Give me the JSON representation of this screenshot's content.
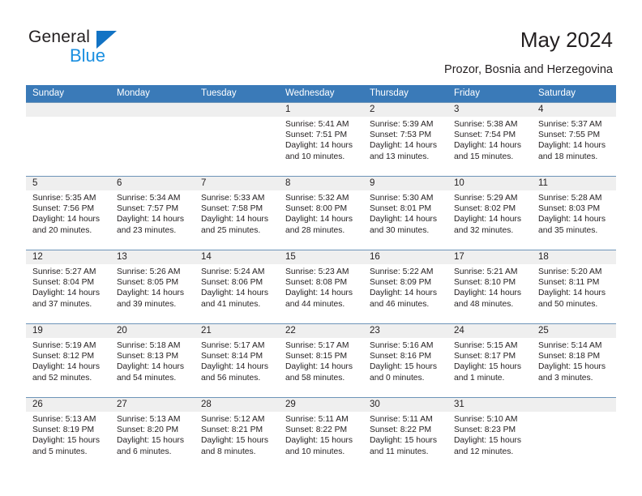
{
  "logo": {
    "primary_text": "General",
    "secondary_text": "Blue",
    "primary_color": "#231f20",
    "secondary_color": "#1a8fe0",
    "triangle_color": "#1273c4"
  },
  "header": {
    "title": "May 2024",
    "subtitle": "Prozor, Bosnia and Herzegovina"
  },
  "theme": {
    "header_row_bg": "#3a7ab8",
    "header_row_text": "#ffffff",
    "daynum_band_bg": "#efefef",
    "row_divider": "#6d94b8",
    "body_text": "#231f20"
  },
  "weekdays": [
    "Sunday",
    "Monday",
    "Tuesday",
    "Wednesday",
    "Thursday",
    "Friday",
    "Saturday"
  ],
  "weeks": [
    [
      {
        "day": "",
        "sunrise": "",
        "sunset": "",
        "daylight_1": "",
        "daylight_2": ""
      },
      {
        "day": "",
        "sunrise": "",
        "sunset": "",
        "daylight_1": "",
        "daylight_2": ""
      },
      {
        "day": "",
        "sunrise": "",
        "sunset": "",
        "daylight_1": "",
        "daylight_2": ""
      },
      {
        "day": "1",
        "sunrise": "Sunrise: 5:41 AM",
        "sunset": "Sunset: 7:51 PM",
        "daylight_1": "Daylight: 14 hours",
        "daylight_2": "and 10 minutes."
      },
      {
        "day": "2",
        "sunrise": "Sunrise: 5:39 AM",
        "sunset": "Sunset: 7:53 PM",
        "daylight_1": "Daylight: 14 hours",
        "daylight_2": "and 13 minutes."
      },
      {
        "day": "3",
        "sunrise": "Sunrise: 5:38 AM",
        "sunset": "Sunset: 7:54 PM",
        "daylight_1": "Daylight: 14 hours",
        "daylight_2": "and 15 minutes."
      },
      {
        "day": "4",
        "sunrise": "Sunrise: 5:37 AM",
        "sunset": "Sunset: 7:55 PM",
        "daylight_1": "Daylight: 14 hours",
        "daylight_2": "and 18 minutes."
      }
    ],
    [
      {
        "day": "5",
        "sunrise": "Sunrise: 5:35 AM",
        "sunset": "Sunset: 7:56 PM",
        "daylight_1": "Daylight: 14 hours",
        "daylight_2": "and 20 minutes."
      },
      {
        "day": "6",
        "sunrise": "Sunrise: 5:34 AM",
        "sunset": "Sunset: 7:57 PM",
        "daylight_1": "Daylight: 14 hours",
        "daylight_2": "and 23 minutes."
      },
      {
        "day": "7",
        "sunrise": "Sunrise: 5:33 AM",
        "sunset": "Sunset: 7:58 PM",
        "daylight_1": "Daylight: 14 hours",
        "daylight_2": "and 25 minutes."
      },
      {
        "day": "8",
        "sunrise": "Sunrise: 5:32 AM",
        "sunset": "Sunset: 8:00 PM",
        "daylight_1": "Daylight: 14 hours",
        "daylight_2": "and 28 minutes."
      },
      {
        "day": "9",
        "sunrise": "Sunrise: 5:30 AM",
        "sunset": "Sunset: 8:01 PM",
        "daylight_1": "Daylight: 14 hours",
        "daylight_2": "and 30 minutes."
      },
      {
        "day": "10",
        "sunrise": "Sunrise: 5:29 AM",
        "sunset": "Sunset: 8:02 PM",
        "daylight_1": "Daylight: 14 hours",
        "daylight_2": "and 32 minutes."
      },
      {
        "day": "11",
        "sunrise": "Sunrise: 5:28 AM",
        "sunset": "Sunset: 8:03 PM",
        "daylight_1": "Daylight: 14 hours",
        "daylight_2": "and 35 minutes."
      }
    ],
    [
      {
        "day": "12",
        "sunrise": "Sunrise: 5:27 AM",
        "sunset": "Sunset: 8:04 PM",
        "daylight_1": "Daylight: 14 hours",
        "daylight_2": "and 37 minutes."
      },
      {
        "day": "13",
        "sunrise": "Sunrise: 5:26 AM",
        "sunset": "Sunset: 8:05 PM",
        "daylight_1": "Daylight: 14 hours",
        "daylight_2": "and 39 minutes."
      },
      {
        "day": "14",
        "sunrise": "Sunrise: 5:24 AM",
        "sunset": "Sunset: 8:06 PM",
        "daylight_1": "Daylight: 14 hours",
        "daylight_2": "and 41 minutes."
      },
      {
        "day": "15",
        "sunrise": "Sunrise: 5:23 AM",
        "sunset": "Sunset: 8:08 PM",
        "daylight_1": "Daylight: 14 hours",
        "daylight_2": "and 44 minutes."
      },
      {
        "day": "16",
        "sunrise": "Sunrise: 5:22 AM",
        "sunset": "Sunset: 8:09 PM",
        "daylight_1": "Daylight: 14 hours",
        "daylight_2": "and 46 minutes."
      },
      {
        "day": "17",
        "sunrise": "Sunrise: 5:21 AM",
        "sunset": "Sunset: 8:10 PM",
        "daylight_1": "Daylight: 14 hours",
        "daylight_2": "and 48 minutes."
      },
      {
        "day": "18",
        "sunrise": "Sunrise: 5:20 AM",
        "sunset": "Sunset: 8:11 PM",
        "daylight_1": "Daylight: 14 hours",
        "daylight_2": "and 50 minutes."
      }
    ],
    [
      {
        "day": "19",
        "sunrise": "Sunrise: 5:19 AM",
        "sunset": "Sunset: 8:12 PM",
        "daylight_1": "Daylight: 14 hours",
        "daylight_2": "and 52 minutes."
      },
      {
        "day": "20",
        "sunrise": "Sunrise: 5:18 AM",
        "sunset": "Sunset: 8:13 PM",
        "daylight_1": "Daylight: 14 hours",
        "daylight_2": "and 54 minutes."
      },
      {
        "day": "21",
        "sunrise": "Sunrise: 5:17 AM",
        "sunset": "Sunset: 8:14 PM",
        "daylight_1": "Daylight: 14 hours",
        "daylight_2": "and 56 minutes."
      },
      {
        "day": "22",
        "sunrise": "Sunrise: 5:17 AM",
        "sunset": "Sunset: 8:15 PM",
        "daylight_1": "Daylight: 14 hours",
        "daylight_2": "and 58 minutes."
      },
      {
        "day": "23",
        "sunrise": "Sunrise: 5:16 AM",
        "sunset": "Sunset: 8:16 PM",
        "daylight_1": "Daylight: 15 hours",
        "daylight_2": "and 0 minutes."
      },
      {
        "day": "24",
        "sunrise": "Sunrise: 5:15 AM",
        "sunset": "Sunset: 8:17 PM",
        "daylight_1": "Daylight: 15 hours",
        "daylight_2": "and 1 minute."
      },
      {
        "day": "25",
        "sunrise": "Sunrise: 5:14 AM",
        "sunset": "Sunset: 8:18 PM",
        "daylight_1": "Daylight: 15 hours",
        "daylight_2": "and 3 minutes."
      }
    ],
    [
      {
        "day": "26",
        "sunrise": "Sunrise: 5:13 AM",
        "sunset": "Sunset: 8:19 PM",
        "daylight_1": "Daylight: 15 hours",
        "daylight_2": "and 5 minutes."
      },
      {
        "day": "27",
        "sunrise": "Sunrise: 5:13 AM",
        "sunset": "Sunset: 8:20 PM",
        "daylight_1": "Daylight: 15 hours",
        "daylight_2": "and 6 minutes."
      },
      {
        "day": "28",
        "sunrise": "Sunrise: 5:12 AM",
        "sunset": "Sunset: 8:21 PM",
        "daylight_1": "Daylight: 15 hours",
        "daylight_2": "and 8 minutes."
      },
      {
        "day": "29",
        "sunrise": "Sunrise: 5:11 AM",
        "sunset": "Sunset: 8:22 PM",
        "daylight_1": "Daylight: 15 hours",
        "daylight_2": "and 10 minutes."
      },
      {
        "day": "30",
        "sunrise": "Sunrise: 5:11 AM",
        "sunset": "Sunset: 8:22 PM",
        "daylight_1": "Daylight: 15 hours",
        "daylight_2": "and 11 minutes."
      },
      {
        "day": "31",
        "sunrise": "Sunrise: 5:10 AM",
        "sunset": "Sunset: 8:23 PM",
        "daylight_1": "Daylight: 15 hours",
        "daylight_2": "and 12 minutes."
      },
      {
        "day": "",
        "sunrise": "",
        "sunset": "",
        "daylight_1": "",
        "daylight_2": ""
      }
    ]
  ]
}
